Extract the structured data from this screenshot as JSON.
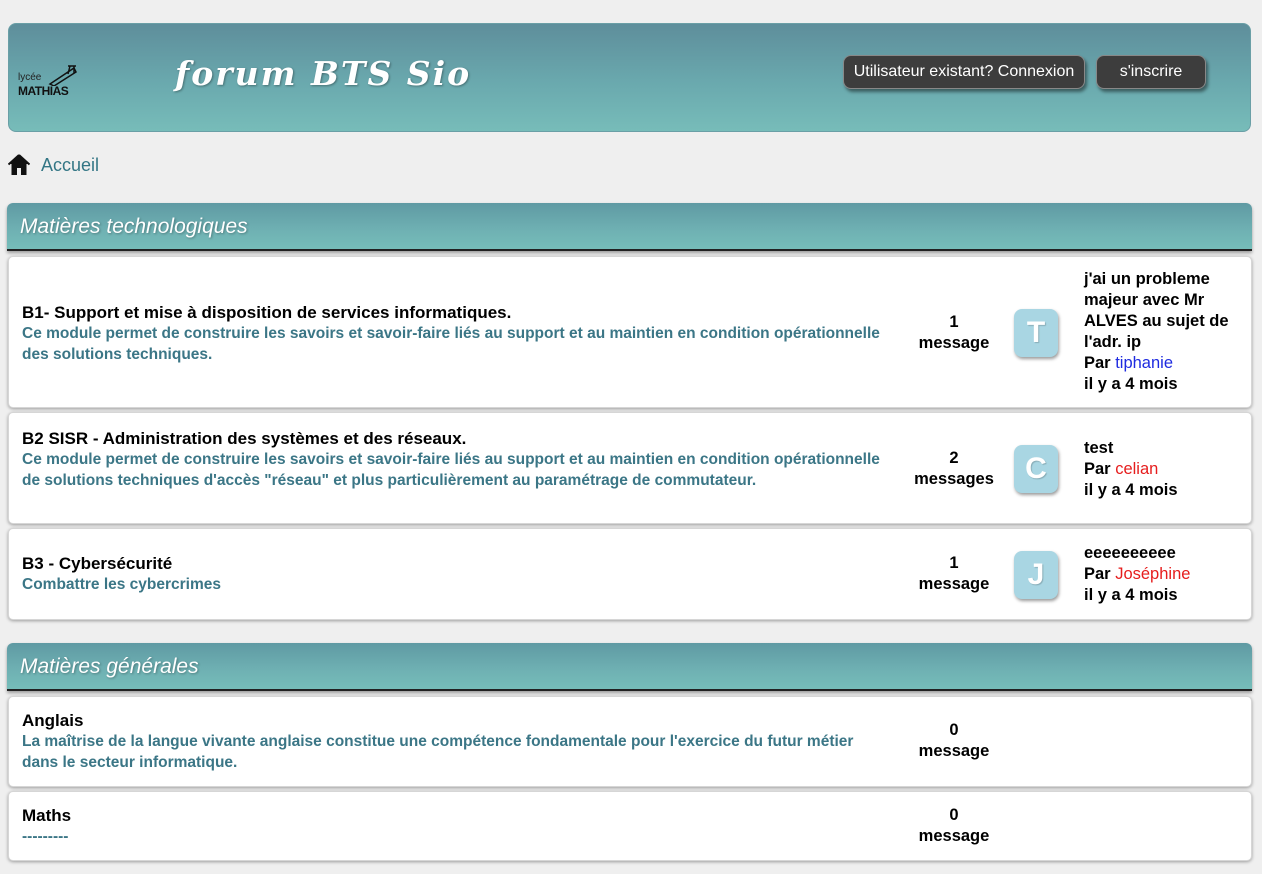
{
  "header": {
    "logo_small": "lycée",
    "logo_big": "MATHIAS",
    "title": "forum BTS Sio",
    "login_button": "Utilisateur existant? Connexion",
    "signup_button": "s'inscrire"
  },
  "breadcrumb": {
    "home_label": "Accueil"
  },
  "sections": [
    {
      "title": "Matières technologiques",
      "forums": [
        {
          "title": "B1- Support et mise à disposition de services informatiques.",
          "description": "Ce module permet de construire les savoirs et savoir-faire liés au support et au maintien en condition opérationnelle des solutions techniques.",
          "count": "1",
          "count_label": "message",
          "avatar_letter": "T",
          "last_topic": "j'ai un probleme majeur avec Mr ALVES au sujet de l'adr. ip",
          "by_label": "Par",
          "author": "tiphanie",
          "author_color": "#1e2be0",
          "time": "il y a 4 mois"
        },
        {
          "title": "B2 SISR - Administration des systèmes et des réseaux.",
          "description": "Ce module permet de construire les savoirs et savoir-faire liés au support et au maintien en condition opérationnelle de solutions techniques d'accès \"réseau\" et plus particulièrement au paramétrage de commutateur.",
          "count": "2",
          "count_label": "messages",
          "avatar_letter": "C",
          "last_topic": "test",
          "by_label": "Par",
          "author": "celian",
          "author_color": "#e61d1d",
          "time": "il y a 4 mois"
        },
        {
          "title": "B3 - Cybersécurité",
          "description": "Combattre les cybercrimes",
          "count": "1",
          "count_label": "message",
          "avatar_letter": "J",
          "last_topic": "eeeeeeeeee",
          "by_label": "Par",
          "author": "Joséphine",
          "author_color": "#e61d1d",
          "time": "il y a 4 mois"
        }
      ]
    },
    {
      "title": "Matières générales",
      "forums": [
        {
          "title": "Anglais",
          "description": "La maîtrise de la langue vivante anglaise constitue une compétence fondamentale pour l'exercice du futur métier dans le secteur informatique.",
          "count": "0",
          "count_label": "message"
        },
        {
          "title": "Maths",
          "description": "---------",
          "count": "0",
          "count_label": "message"
        }
      ]
    }
  ],
  "colors": {
    "accent": "#6aa9ae",
    "link": "#337685",
    "avatar_bg": "#a9d6e3"
  }
}
